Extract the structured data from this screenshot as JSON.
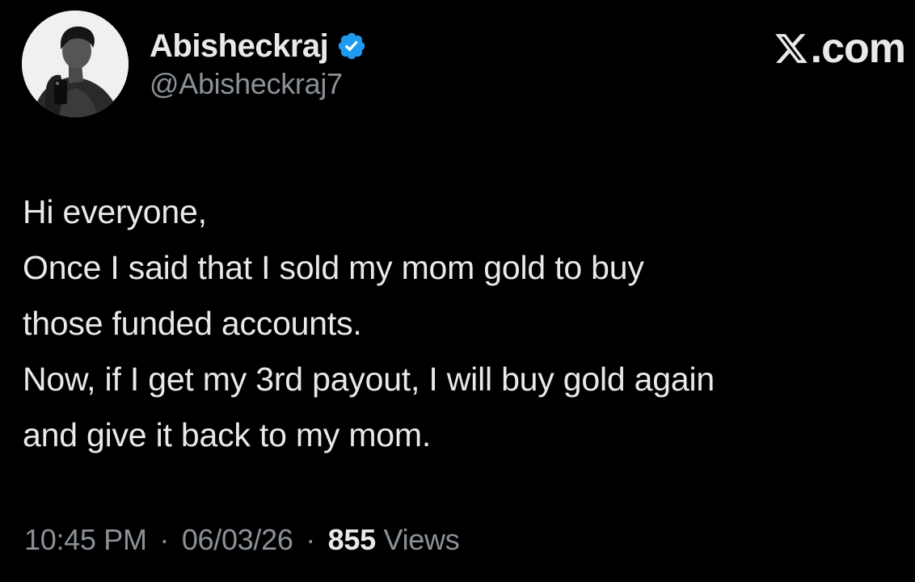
{
  "author": {
    "display_name": "Abisheckraj",
    "handle": "@Abisheckraj7",
    "verified_icon": "verified-badge-icon",
    "verified_color": "#1d9bf0"
  },
  "brand": {
    "label": ".com",
    "icon": "x-logo-icon"
  },
  "tweet": {
    "lines": [
      "Hi everyone,",
      "Once I said that I sold my mom gold to buy",
      "those funded accounts.",
      "Now, if I get my 3rd payout, I will buy gold again",
      "and give it back to my mom."
    ]
  },
  "meta": {
    "time": "10:45 PM",
    "separator": "·",
    "date": "06/03/26",
    "views_count": "855",
    "views_label": "Views"
  },
  "colors": {
    "background": "#000000",
    "primary_text": "#e7e9ea",
    "secondary_text": "#8b9197"
  }
}
